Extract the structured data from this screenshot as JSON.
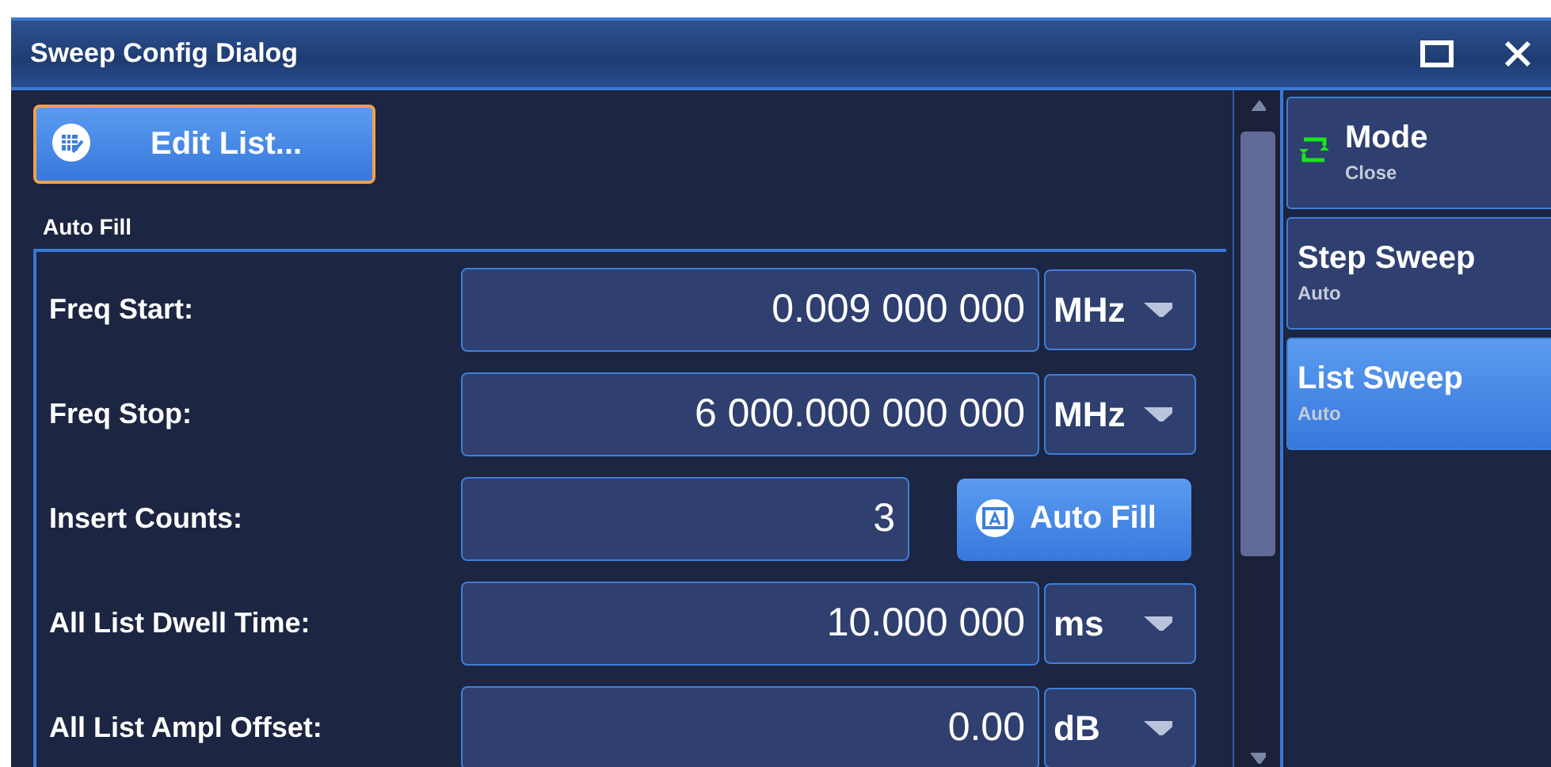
{
  "window": {
    "title": "Sweep Config Dialog"
  },
  "edit_list_button": {
    "label": "Edit List..."
  },
  "section": {
    "title": "Auto Fill",
    "rows": [
      {
        "kind": "unit",
        "label": "Freq Start:",
        "value": "0.009 000 000",
        "unit": "MHz"
      },
      {
        "kind": "unit",
        "label": "Freq Stop:",
        "value": "6 000.000 000 000",
        "unit": "MHz"
      },
      {
        "kind": "action",
        "label": "Insert Counts:",
        "value": "3",
        "button": "Auto Fill"
      },
      {
        "kind": "unit",
        "label": "All List Dwell Time:",
        "value": "10.000 000",
        "unit": "ms"
      },
      {
        "kind": "unit",
        "label": "All List Ampl Offset:",
        "value": "0.00",
        "unit": "dB"
      }
    ]
  },
  "softkeys": [
    {
      "kind": "menu",
      "label": "Mode",
      "sublabel": "Close",
      "selected": false
    },
    {
      "kind": "option",
      "label": "Step Sweep",
      "sublabel": "Auto",
      "selected": false
    },
    {
      "kind": "option",
      "label": "List Sweep",
      "sublabel": "Auto",
      "selected": true
    }
  ]
}
